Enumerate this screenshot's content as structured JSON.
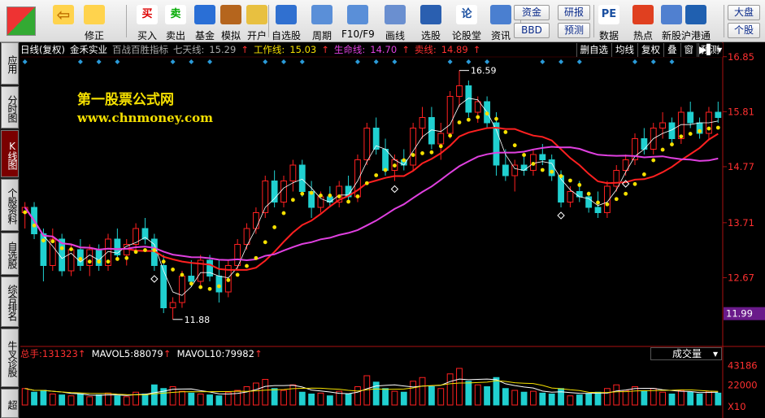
{
  "toolbar": {
    "items": [
      {
        "id": "back",
        "label": "",
        "icon": "back-arrow-icon"
      },
      {
        "id": "fix",
        "label": "修正",
        "icon": "fix-icon"
      },
      {
        "id": "buy",
        "label": "买入",
        "icon": "buy-icon",
        "glyph": "买"
      },
      {
        "id": "sell",
        "label": "卖出",
        "icon": "sell-icon",
        "glyph": "卖"
      },
      {
        "id": "fund",
        "label": "基金",
        "icon": "fund-icon"
      },
      {
        "id": "sim",
        "label": "模拟",
        "icon": "hammer-icon"
      },
      {
        "id": "open",
        "label": "开户",
        "icon": "lock-icon"
      },
      {
        "id": "zixuan",
        "label": "自选股",
        "icon": "star-icon"
      },
      {
        "id": "period",
        "label": "周期",
        "icon": "clock-icon"
      },
      {
        "id": "f10",
        "label": "F10/F9",
        "icon": "f10-icon"
      },
      {
        "id": "draw",
        "label": "画线",
        "icon": "pencil-icon"
      },
      {
        "id": "select",
        "label": "选股",
        "icon": "select-icon"
      },
      {
        "id": "forum",
        "label": "论股堂",
        "icon": "forum-icon",
        "glyph": "论"
      },
      {
        "id": "news",
        "label": "资讯",
        "icon": "news-icon"
      },
      {
        "id": "data",
        "label": "数据",
        "icon": "pe-icon",
        "glyph": "PE"
      },
      {
        "id": "hot",
        "label": "热点",
        "icon": "hot-icon"
      },
      {
        "id": "newstock",
        "label": "新股",
        "icon": "newstock-icon"
      },
      {
        "id": "hk",
        "label": "沪港通",
        "icon": "hk-icon"
      }
    ],
    "small_buttons": {
      "zijin": "资金",
      "bbd": "BBD",
      "yanbao": "研报",
      "yuce": "预测",
      "dapan": "大盘",
      "gegu": "个股"
    }
  },
  "sidetabs": [
    "应用",
    "分时图",
    "K线图",
    "个股资料",
    "自选股",
    "综合排名",
    "牛叉诊股",
    "超"
  ],
  "infobar": {
    "period": "日线(复权)",
    "stock": "金禾实业",
    "indicator": "百战百胜指标",
    "qitian_label": "七天线:",
    "qitian_val": "15.29",
    "work_label": "工作线:",
    "work_val": "15.03",
    "life_label": "生命线:",
    "life_val": "14.70",
    "sell_label": "卖线:",
    "sell_val": "14.89"
  },
  "right_buttons": [
    "删自选",
    "均线",
    "复权",
    "叠",
    "窗",
    "预测"
  ],
  "watermark": {
    "line1": "第一股票公式网",
    "line2": "www.chnmoney.com"
  },
  "volume": {
    "total_label": "总手:",
    "total_val": "131323",
    "ma5_label": "MAVOL5:",
    "ma5_val": "88079",
    "ma10_label": "MAVOL10:",
    "ma10_val": "79982",
    "dropdown": "成交量"
  },
  "colors": {
    "up": "#ff2020",
    "down": "#20d0d0",
    "ma_work": "#ff2020",
    "ma_life": "#e040e0",
    "sell": "#f5e000",
    "qitian": "#ffffff"
  },
  "chart_data": {
    "type": "candlestick",
    "price_ylim": [
      11.4,
      17.0
    ],
    "price_ticks": [
      "16.85",
      "15.81",
      "14.77",
      "13.71",
      "12.67"
    ],
    "current_price": "11.99",
    "annot_high": "16.59",
    "annot_low": "11.88",
    "volume_ticks": [
      "43186",
      "22000",
      "X10"
    ],
    "volume_ylim": [
      0,
      48000
    ],
    "candles": [
      [
        13.9,
        14.1,
        13.6,
        14.0
      ],
      [
        14.0,
        14.1,
        13.4,
        13.5
      ],
      [
        13.5,
        13.6,
        12.6,
        12.9
      ],
      [
        12.9,
        13.6,
        12.8,
        13.4
      ],
      [
        13.4,
        13.5,
        12.7,
        12.8
      ],
      [
        12.8,
        13.3,
        12.7,
        13.2
      ],
      [
        13.2,
        13.4,
        12.8,
        12.9
      ],
      [
        12.9,
        13.3,
        12.7,
        13.2
      ],
      [
        13.2,
        13.3,
        12.8,
        12.9
      ],
      [
        12.9,
        13.5,
        12.8,
        13.4
      ],
      [
        13.4,
        13.6,
        13.0,
        13.1
      ],
      [
        13.1,
        13.4,
        12.9,
        13.3
      ],
      [
        13.3,
        13.7,
        13.2,
        13.6
      ],
      [
        13.6,
        13.8,
        13.3,
        13.4
      ],
      [
        13.4,
        13.5,
        12.8,
        12.9
      ],
      [
        12.9,
        13.1,
        12.0,
        12.1
      ],
      [
        12.1,
        12.3,
        11.88,
        12.2
      ],
      [
        12.2,
        12.8,
        12.1,
        12.7
      ],
      [
        12.7,
        13.0,
        12.5,
        12.6
      ],
      [
        12.6,
        13.1,
        12.5,
        13.0
      ],
      [
        13.0,
        13.1,
        12.6,
        12.7
      ],
      [
        12.7,
        13.0,
        12.2,
        12.4
      ],
      [
        12.4,
        13.0,
        12.3,
        12.9
      ],
      [
        12.9,
        13.4,
        12.8,
        13.3
      ],
      [
        13.3,
        13.7,
        13.2,
        13.6
      ],
      [
        13.6,
        14.0,
        13.5,
        13.9
      ],
      [
        13.9,
        14.6,
        13.8,
        14.5
      ],
      [
        14.5,
        14.7,
        14.0,
        14.1
      ],
      [
        14.1,
        14.6,
        14.0,
        14.5
      ],
      [
        14.5,
        14.9,
        14.3,
        14.8
      ],
      [
        14.8,
        14.9,
        14.2,
        14.3
      ],
      [
        14.3,
        14.5,
        13.8,
        14.0
      ],
      [
        14.0,
        14.3,
        13.9,
        14.2
      ],
      [
        14.2,
        14.4,
        14.0,
        14.1
      ],
      [
        14.1,
        14.5,
        14.0,
        14.4
      ],
      [
        14.4,
        14.6,
        14.1,
        14.2
      ],
      [
        14.2,
        15.0,
        14.1,
        14.9
      ],
      [
        14.9,
        15.6,
        14.8,
        15.5
      ],
      [
        15.5,
        15.7,
        15.0,
        15.1
      ],
      [
        15.1,
        15.3,
        14.6,
        14.7
      ],
      [
        14.7,
        15.0,
        14.5,
        14.9
      ],
      [
        14.9,
        15.1,
        14.7,
        14.8
      ],
      [
        14.8,
        15.6,
        14.7,
        15.5
      ],
      [
        15.5,
        15.9,
        15.3,
        15.7
      ],
      [
        15.7,
        15.9,
        15.1,
        15.2
      ],
      [
        15.2,
        15.6,
        14.9,
        15.4
      ],
      [
        15.4,
        16.2,
        15.3,
        16.1
      ],
      [
        16.1,
        16.59,
        15.9,
        16.3
      ],
      [
        16.3,
        16.4,
        15.7,
        15.8
      ],
      [
        15.8,
        16.1,
        15.6,
        16.0
      ],
      [
        16.0,
        16.1,
        15.5,
        15.6
      ],
      [
        15.6,
        15.8,
        14.6,
        14.8
      ],
      [
        14.8,
        15.1,
        14.5,
        14.6
      ],
      [
        14.6,
        14.9,
        14.3,
        14.8
      ],
      [
        14.8,
        15.0,
        14.6,
        14.7
      ],
      [
        14.7,
        15.1,
        14.6,
        15.0
      ],
      [
        15.0,
        15.2,
        14.8,
        14.9
      ],
      [
        14.9,
        15.0,
        14.5,
        14.6
      ],
      [
        14.6,
        14.7,
        14.0,
        14.1
      ],
      [
        14.1,
        14.4,
        14.0,
        14.3
      ],
      [
        14.3,
        14.5,
        14.1,
        14.2
      ],
      [
        14.2,
        14.3,
        13.9,
        14.0
      ],
      [
        14.0,
        14.3,
        13.8,
        13.9
      ],
      [
        13.9,
        14.5,
        13.8,
        14.4
      ],
      [
        14.4,
        14.8,
        14.3,
        14.7
      ],
      [
        14.7,
        15.0,
        14.6,
        14.9
      ],
      [
        14.9,
        15.4,
        14.8,
        15.3
      ],
      [
        15.3,
        15.5,
        15.0,
        15.1
      ],
      [
        15.1,
        15.6,
        15.0,
        15.5
      ],
      [
        15.5,
        15.8,
        15.3,
        15.6
      ],
      [
        15.6,
        15.7,
        15.2,
        15.3
      ],
      [
        15.3,
        15.9,
        15.2,
        15.8
      ],
      [
        15.8,
        16.0,
        15.5,
        15.6
      ],
      [
        15.6,
        15.7,
        15.3,
        15.4
      ],
      [
        15.4,
        15.9,
        15.3,
        15.8
      ],
      [
        15.8,
        16.0,
        15.6,
        15.7
      ]
    ],
    "volumes": [
      18,
      14,
      16,
      12,
      11,
      10,
      12,
      9,
      11,
      13,
      10,
      9,
      14,
      12,
      22,
      18,
      20,
      15,
      13,
      12,
      11,
      10,
      14,
      16,
      20,
      24,
      28,
      18,
      16,
      22,
      14,
      12,
      13,
      10,
      15,
      12,
      20,
      32,
      25,
      18,
      15,
      14,
      26,
      30,
      20,
      18,
      34,
      40,
      26,
      22,
      20,
      30,
      18,
      16,
      14,
      15,
      13,
      12,
      18,
      10,
      11,
      12,
      14,
      18,
      22,
      16,
      20,
      15,
      18,
      14,
      12,
      16,
      14,
      12,
      15,
      13
    ]
  }
}
